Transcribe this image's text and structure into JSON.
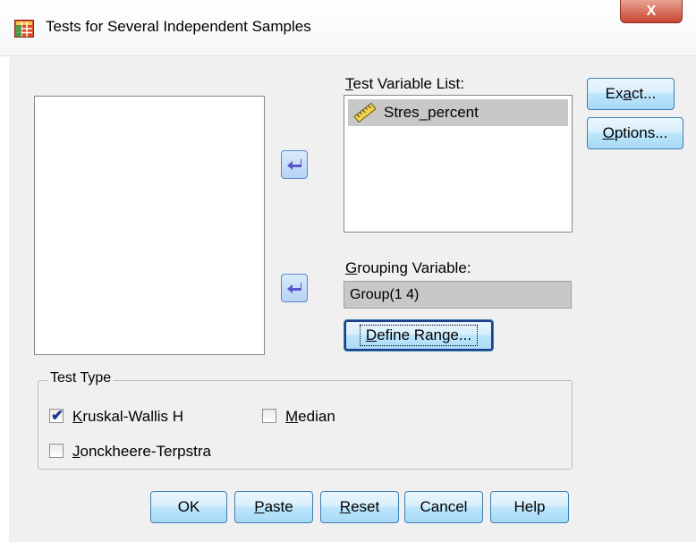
{
  "window": {
    "title": "Tests for Several Independent Samples",
    "close_label": "X"
  },
  "test_variable_list": {
    "label_underlined": "T",
    "label_rest": "est Variable List:",
    "items": [
      {
        "name": "Stres_percent",
        "icon": "scale-ruler-icon",
        "selected": true
      }
    ]
  },
  "grouping_variable": {
    "label_underlined": "G",
    "label_rest": "rouping Variable:",
    "value": "Group(1 4)"
  },
  "define_range_button": {
    "label_underlined": "D",
    "label_rest": "efine Range..."
  },
  "side_buttons": {
    "exact": {
      "label_pre": "Ex",
      "label_underlined": "a",
      "label_post": "ct..."
    },
    "options": {
      "label_underlined": "O",
      "label_rest": "ptions..."
    }
  },
  "test_type": {
    "legend": "Test Type",
    "kruskal": {
      "label_underlined": "K",
      "label_rest": "ruskal-Wallis H",
      "checked": true
    },
    "median": {
      "label_underlined": "M",
      "label_rest": "edian",
      "checked": false
    },
    "jonckheere": {
      "label_underlined": "J",
      "label_rest": "onckheere-Terpstra",
      "checked": false
    }
  },
  "bottom_buttons": {
    "ok": "OK",
    "paste": {
      "label_underlined": "P",
      "label_rest": "aste"
    },
    "reset": {
      "label_underlined": "R",
      "label_rest": "eset"
    },
    "cancel": "Cancel",
    "help": "Help"
  },
  "colors": {
    "selection": "#c8c8c8",
    "button_border": "#3c7fb1",
    "arrow_fill": "#5a55c9",
    "check": "#1f3a93"
  }
}
